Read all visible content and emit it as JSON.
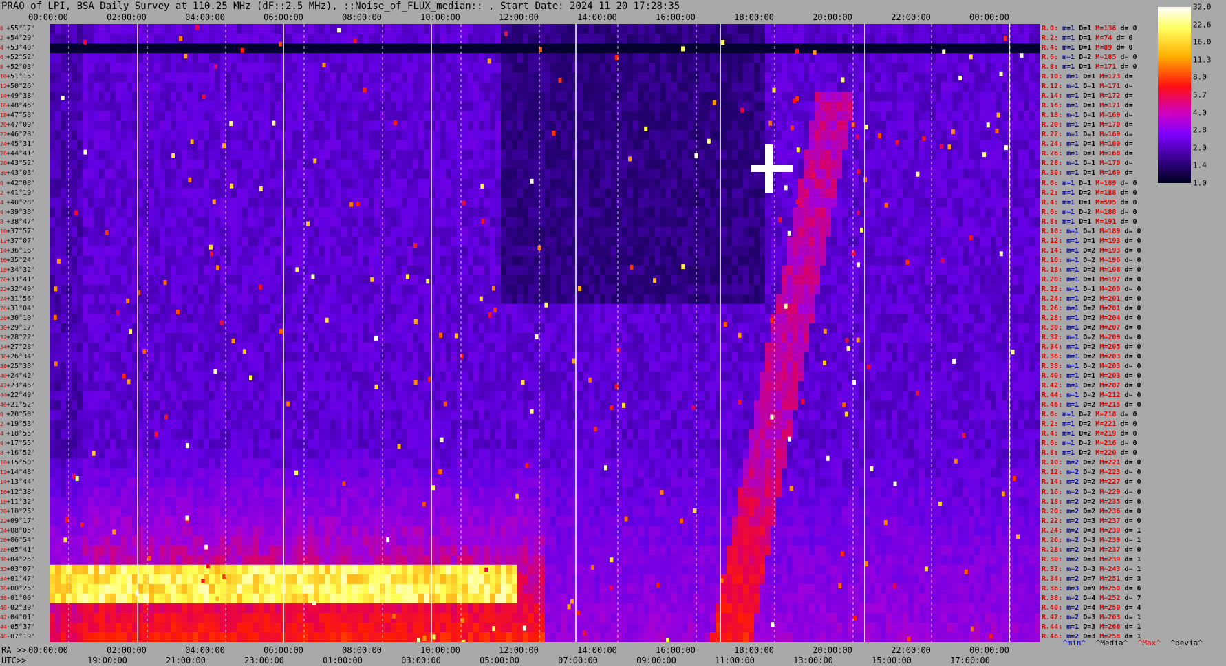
{
  "title": "PRAO of LPI, BSA Daily Survey at 110.25 MHz (dF::2.5 MHz), ::Noise_of_FLUX_median:: , Start Date: 2024 11 20 17:28:35",
  "chart_data": {
    "type": "heatmap",
    "title": "PRAO of LPI, BSA Daily Survey at 110.25 MHz (dF::2.5 MHz), ::Noise_of_FLUX_median:: , Start Date: 2024 11 20 17:28:35",
    "top_ticks": [
      "00:00:00",
      "02:00:00",
      "04:00:00",
      "06:00:00",
      "08:00:00",
      "10:00:00",
      "12:00:00",
      "14:00:00",
      "16:00:00",
      "18:00:00",
      "20:00:00",
      "22:00:00",
      "00:00:00"
    ],
    "ra_axis_label": "RA >>",
    "ra_ticks": [
      "00:00:00",
      "02:00:00",
      "04:00:00",
      "06:00:00",
      "08:00:00",
      "10:00:00",
      "12:00:00",
      "14:00:00",
      "16:00:00",
      "18:00:00",
      "20:00:00",
      "22:00:00",
      "00:00:00"
    ],
    "utc_axis_label": "UTC>>",
    "utc_ticks": [
      "19:00:00",
      "21:00:00",
      "23:00:00",
      "01:00:00",
      "03:00:00",
      "05:00:00",
      "07:00:00",
      "09:00:00",
      "11:00:00",
      "13:00:00",
      "15:00:00",
      "17:00:00"
    ],
    "dec_rows": [
      {
        "i": "0",
        "dec": "+55°17'"
      },
      {
        "i": "2",
        "dec": "+54°29'"
      },
      {
        "i": "4",
        "dec": "+53°40'"
      },
      {
        "i": "6",
        "dec": "+52°52'"
      },
      {
        "i": "8",
        "dec": "+52°03'"
      },
      {
        "i": "10",
        "dec": "+51°15'"
      },
      {
        "i": "12",
        "dec": "+50°26'"
      },
      {
        "i": "14",
        "dec": "+49°38'"
      },
      {
        "i": "16",
        "dec": "+48°46'"
      },
      {
        "i": "18",
        "dec": "+47°58'"
      },
      {
        "i": "20",
        "dec": "+47°09'"
      },
      {
        "i": "22",
        "dec": "+46°20'"
      },
      {
        "i": "24",
        "dec": "+45°31'"
      },
      {
        "i": "26",
        "dec": "+44°41'"
      },
      {
        "i": "28",
        "dec": "+43°52'"
      },
      {
        "i": "30",
        "dec": "+43°03'"
      },
      {
        "i": "0",
        "dec": "+42°08'"
      },
      {
        "i": "2",
        "dec": "+41°19'"
      },
      {
        "i": "4",
        "dec": "+40°28'"
      },
      {
        "i": "6",
        "dec": "+39°38'"
      },
      {
        "i": "8",
        "dec": "+38°47'"
      },
      {
        "i": "10",
        "dec": "+37°57'"
      },
      {
        "i": "12",
        "dec": "+37°07'"
      },
      {
        "i": "14",
        "dec": "+36°16'"
      },
      {
        "i": "16",
        "dec": "+35°24'"
      },
      {
        "i": "18",
        "dec": "+34°32'"
      },
      {
        "i": "20",
        "dec": "+33°41'"
      },
      {
        "i": "22",
        "dec": "+32°49'"
      },
      {
        "i": "24",
        "dec": "+31°56'"
      },
      {
        "i": "26",
        "dec": "+31°04'"
      },
      {
        "i": "28",
        "dec": "+30°10'"
      },
      {
        "i": "30",
        "dec": "+29°17'"
      },
      {
        "i": "32",
        "dec": "+28°22'"
      },
      {
        "i": "34",
        "dec": "+27°28'"
      },
      {
        "i": "36",
        "dec": "+26°34'"
      },
      {
        "i": "38",
        "dec": "+25°38'"
      },
      {
        "i": "40",
        "dec": "+24°42'"
      },
      {
        "i": "42",
        "dec": "+23°46'"
      },
      {
        "i": "44",
        "dec": "+22°49'"
      },
      {
        "i": "46",
        "dec": "+21°52'"
      },
      {
        "i": "0",
        "dec": "+20°50'"
      },
      {
        "i": "2",
        "dec": "+19°53'"
      },
      {
        "i": "4",
        "dec": "+18°55'"
      },
      {
        "i": "6",
        "dec": "+17°55'"
      },
      {
        "i": "8",
        "dec": "+16°52'"
      },
      {
        "i": "10",
        "dec": "+15°50'"
      },
      {
        "i": "12",
        "dec": "+14°48'"
      },
      {
        "i": "14",
        "dec": "+13°44'"
      },
      {
        "i": "16",
        "dec": "+12°38'"
      },
      {
        "i": "18",
        "dec": "+11°32'"
      },
      {
        "i": "20",
        "dec": "+10°25'"
      },
      {
        "i": "22",
        "dec": "+09°17'"
      },
      {
        "i": "24",
        "dec": "+08°05'"
      },
      {
        "i": "26",
        "dec": "+06°54'"
      },
      {
        "i": "28",
        "dec": "+05°41'"
      },
      {
        "i": "30",
        "dec": "+04°25'"
      },
      {
        "i": "32",
        "dec": "+03°07'"
      },
      {
        "i": "34",
        "dec": "+01°47'"
      },
      {
        "i": "36",
        "dec": "+00°25'"
      },
      {
        "i": "38",
        "dec": "-01°00'"
      },
      {
        "i": "40",
        "dec": "-02°30'"
      },
      {
        "i": "42",
        "dec": "-04°01'"
      },
      {
        "i": "44",
        "dec": "-05°37'"
      },
      {
        "i": "46",
        "dec": "-07°19'"
      }
    ],
    "stats_rows": [
      {
        "r": "R.0:",
        "m": "m=1",
        "d": "D=1",
        "h": "M=136",
        "dd": "d= 0"
      },
      {
        "r": "R.2:",
        "m": "m=1",
        "d": "D=1",
        "h": "M=74",
        "dd": "d= 0"
      },
      {
        "r": "R.4:",
        "m": "m=1",
        "d": "D=1",
        "h": "M=89",
        "dd": "d= 0"
      },
      {
        "r": "R.6:",
        "m": "m=1",
        "d": "D=2",
        "h": "M=185",
        "dd": "d= 0"
      },
      {
        "r": "R.8:",
        "m": "m=1",
        "d": "D=1",
        "h": "M=171",
        "dd": "d= 0"
      },
      {
        "r": "R.10:",
        "m": "m=1",
        "d": "D=1",
        "h": "M=173",
        "dd": "d="
      },
      {
        "r": "R.12:",
        "m": "m=1",
        "d": "D=1",
        "h": "M=171",
        "dd": "d="
      },
      {
        "r": "R.14:",
        "m": "m=1",
        "d": "D=1",
        "h": "M=172",
        "dd": "d="
      },
      {
        "r": "R.16:",
        "m": "m=1",
        "d": "D=1",
        "h": "M=171",
        "dd": "d="
      },
      {
        "r": "R.18:",
        "m": "m=1",
        "d": "D=1",
        "h": "M=169",
        "dd": "d="
      },
      {
        "r": "R.20:",
        "m": "m=1",
        "d": "D=1",
        "h": "M=170",
        "dd": "d="
      },
      {
        "r": "R.22:",
        "m": "m=1",
        "d": "D=1",
        "h": "M=169",
        "dd": "d="
      },
      {
        "r": "R.24:",
        "m": "m=1",
        "d": "D=1",
        "h": "M=180",
        "dd": "d="
      },
      {
        "r": "R.26:",
        "m": "m=1",
        "d": "D=1",
        "h": "M=168",
        "dd": "d="
      },
      {
        "r": "R.28:",
        "m": "m=1",
        "d": "D=1",
        "h": "M=170",
        "dd": "d="
      },
      {
        "r": "R.30:",
        "m": "m=1",
        "d": "D=1",
        "h": "M=169",
        "dd": "d="
      },
      {
        "r": "R.0:",
        "m": "m=1",
        "d": "D=1",
        "h": "M=189",
        "dd": "d= 0"
      },
      {
        "r": "R.2:",
        "m": "m=1",
        "d": "D=2",
        "h": "M=188",
        "dd": "d= 0"
      },
      {
        "r": "R.4:",
        "m": "m=1",
        "d": "D=1",
        "h": "M=595",
        "dd": "d= 0"
      },
      {
        "r": "R.6:",
        "m": "m=1",
        "d": "D=2",
        "h": "M=188",
        "dd": "d= 0"
      },
      {
        "r": "R.8:",
        "m": "m=1",
        "d": "D=1",
        "h": "M=191",
        "dd": "d= 0"
      },
      {
        "r": "R.10:",
        "m": "m=1",
        "d": "D=1",
        "h": "M=189",
        "dd": "d= 0"
      },
      {
        "r": "R.12:",
        "m": "m=1",
        "d": "D=1",
        "h": "M=193",
        "dd": "d= 0"
      },
      {
        "r": "R.14:",
        "m": "m=1",
        "d": "D=2",
        "h": "M=193",
        "dd": "d= 0"
      },
      {
        "r": "R.16:",
        "m": "m=1",
        "d": "D=2",
        "h": "M=196",
        "dd": "d= 0"
      },
      {
        "r": "R.18:",
        "m": "m=1",
        "d": "D=2",
        "h": "M=196",
        "dd": "d= 0"
      },
      {
        "r": "R.20:",
        "m": "m=1",
        "d": "D=1",
        "h": "M=197",
        "dd": "d= 0"
      },
      {
        "r": "R.22:",
        "m": "m=1",
        "d": "D=1",
        "h": "M=200",
        "dd": "d= 0"
      },
      {
        "r": "R.24:",
        "m": "m=1",
        "d": "D=2",
        "h": "M=201",
        "dd": "d= 0"
      },
      {
        "r": "R.26:",
        "m": "m=1",
        "d": "D=2",
        "h": "M=201",
        "dd": "d= 0"
      },
      {
        "r": "R.28:",
        "m": "m=1",
        "d": "D=2",
        "h": "M=204",
        "dd": "d= 0"
      },
      {
        "r": "R.30:",
        "m": "m=1",
        "d": "D=2",
        "h": "M=207",
        "dd": "d= 0"
      },
      {
        "r": "R.32:",
        "m": "m=1",
        "d": "D=2",
        "h": "M=209",
        "dd": "d= 0"
      },
      {
        "r": "R.34:",
        "m": "m=1",
        "d": "D=2",
        "h": "M=205",
        "dd": "d= 0"
      },
      {
        "r": "R.36:",
        "m": "m=1",
        "d": "D=2",
        "h": "M=203",
        "dd": "d= 0"
      },
      {
        "r": "R.38:",
        "m": "m=1",
        "d": "D=2",
        "h": "M=203",
        "dd": "d= 0"
      },
      {
        "r": "R.40:",
        "m": "m=1",
        "d": "D=1",
        "h": "M=203",
        "dd": "d= 0"
      },
      {
        "r": "R.42:",
        "m": "m=1",
        "d": "D=2",
        "h": "M=207",
        "dd": "d= 0"
      },
      {
        "r": "R.44:",
        "m": "m=1",
        "d": "D=2",
        "h": "M=212",
        "dd": "d= 0"
      },
      {
        "r": "R.46:",
        "m": "m=1",
        "d": "D=2",
        "h": "M=215",
        "dd": "d= 0"
      },
      {
        "r": "R.0:",
        "m": "m=1",
        "d": "D=2",
        "h": "M=218",
        "dd": "d= 0"
      },
      {
        "r": "R.2:",
        "m": "m=1",
        "d": "D=2",
        "h": "M=221",
        "dd": "d= 0"
      },
      {
        "r": "R.4:",
        "m": "m=1",
        "d": "D=2",
        "h": "M=219",
        "dd": "d= 0"
      },
      {
        "r": "R.6:",
        "m": "m=1",
        "d": "D=2",
        "h": "M=216",
        "dd": "d= 0"
      },
      {
        "r": "R.8:",
        "m": "m=1",
        "d": "D=2",
        "h": "M=220",
        "dd": "d= 0"
      },
      {
        "r": "R.10:",
        "m": "m=2",
        "d": "D=2",
        "h": "M=221",
        "dd": "d= 0"
      },
      {
        "r": "R.12:",
        "m": "m=2",
        "d": "D=2",
        "h": "M=223",
        "dd": "d= 0"
      },
      {
        "r": "R.14:",
        "m": "m=2",
        "d": "D=2",
        "h": "M=227",
        "dd": "d= 0"
      },
      {
        "r": "R.16:",
        "m": "m=2",
        "d": "D=2",
        "h": "M=229",
        "dd": "d= 0"
      },
      {
        "r": "R.18:",
        "m": "m=2",
        "d": "D=2",
        "h": "M=235",
        "dd": "d= 0"
      },
      {
        "r": "R.20:",
        "m": "m=2",
        "d": "D=2",
        "h": "M=236",
        "dd": "d= 0"
      },
      {
        "r": "R.22:",
        "m": "m=2",
        "d": "D=3",
        "h": "M=237",
        "dd": "d= 0"
      },
      {
        "r": "R.24:",
        "m": "m=2",
        "d": "D=3",
        "h": "M=239",
        "dd": "d= 1"
      },
      {
        "r": "R.26:",
        "m": "m=2",
        "d": "D=3",
        "h": "M=239",
        "dd": "d= 1"
      },
      {
        "r": "R.28:",
        "m": "m=2",
        "d": "D=3",
        "h": "M=237",
        "dd": "d= 0"
      },
      {
        "r": "R.30:",
        "m": "m=2",
        "d": "D=3",
        "h": "M=239",
        "dd": "d= 1"
      },
      {
        "r": "R.32:",
        "m": "m=2",
        "d": "D=3",
        "h": "M=243",
        "dd": "d= 1"
      },
      {
        "r": "R.34:",
        "m": "m=2",
        "d": "D=7",
        "h": "M=251",
        "dd": "d= 3"
      },
      {
        "r": "R.36:",
        "m": "m=3",
        "d": "D=9",
        "h": "M=250",
        "dd": "d= 6"
      },
      {
        "r": "R.38:",
        "m": "m=2",
        "d": "D=4",
        "h": "M=252",
        "dd": "d= 7"
      },
      {
        "r": "R.40:",
        "m": "m=2",
        "d": "D=4",
        "h": "M=250",
        "dd": "d= 4"
      },
      {
        "r": "R.42:",
        "m": "m=2",
        "d": "D=3",
        "h": "M=263",
        "dd": "d= 1"
      },
      {
        "r": "R.44:",
        "m": "m=1",
        "d": "D=3",
        "h": "M=266",
        "dd": "d= 1"
      },
      {
        "r": "R.46:",
        "m": "m=2",
        "d": "D=3",
        "h": "M=258",
        "dd": "d= 1"
      }
    ],
    "colorbar_ticks": [
      "32.0",
      "22.6",
      "16.0",
      "11.3",
      "8.0",
      "5.7",
      "4.0",
      "2.8",
      "2.0",
      "1.4",
      "1.0"
    ],
    "legend": [
      "^min^",
      "^Media^",
      "^Max^",
      "^devia^"
    ],
    "colors": {
      "background": "#a9a9a9",
      "low": "#00003c",
      "mid": "#8000ff",
      "high": "#ff0000",
      "peak": "#ffffff"
    }
  }
}
